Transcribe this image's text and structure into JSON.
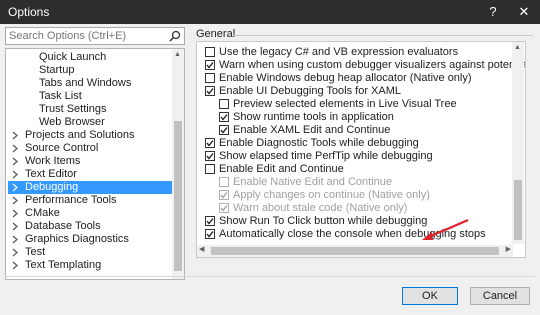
{
  "window": {
    "title": "Options",
    "help_glyph": "?",
    "close_glyph": "✕"
  },
  "search": {
    "placeholder": "Search Options (Ctrl+E)"
  },
  "tree": {
    "items": [
      {
        "label": "Quick Launch",
        "indent": 2,
        "expander": false,
        "selected": false
      },
      {
        "label": "Startup",
        "indent": 2,
        "expander": false,
        "selected": false
      },
      {
        "label": "Tabs and Windows",
        "indent": 2,
        "expander": false,
        "selected": false
      },
      {
        "label": "Task List",
        "indent": 2,
        "expander": false,
        "selected": false
      },
      {
        "label": "Trust Settings",
        "indent": 2,
        "expander": false,
        "selected": false
      },
      {
        "label": "Web Browser",
        "indent": 2,
        "expander": false,
        "selected": false
      },
      {
        "label": "Projects and Solutions",
        "indent": 1,
        "expander": true,
        "selected": false
      },
      {
        "label": "Source Control",
        "indent": 1,
        "expander": true,
        "selected": false
      },
      {
        "label": "Work Items",
        "indent": 1,
        "expander": true,
        "selected": false
      },
      {
        "label": "Text Editor",
        "indent": 1,
        "expander": true,
        "selected": false
      },
      {
        "label": "Debugging",
        "indent": 1,
        "expander": true,
        "selected": true
      },
      {
        "label": "Performance Tools",
        "indent": 1,
        "expander": true,
        "selected": false
      },
      {
        "label": "CMake",
        "indent": 1,
        "expander": true,
        "selected": false
      },
      {
        "label": "Database Tools",
        "indent": 1,
        "expander": true,
        "selected": false
      },
      {
        "label": "Graphics Diagnostics",
        "indent": 1,
        "expander": true,
        "selected": false
      },
      {
        "label": "Test",
        "indent": 1,
        "expander": true,
        "selected": false
      },
      {
        "label": "Text Templating",
        "indent": 1,
        "expander": true,
        "selected": false
      }
    ]
  },
  "section": {
    "title": "General"
  },
  "options": [
    {
      "label": "Use the legacy C# and VB expression evaluators",
      "checked": false,
      "enabled": true,
      "indent": 0
    },
    {
      "label": "Warn when using custom debugger visualizers against potentially unsafe pro",
      "checked": true,
      "enabled": true,
      "indent": 0
    },
    {
      "label": "Enable Windows debug heap allocator (Native only)",
      "checked": false,
      "enabled": true,
      "indent": 0
    },
    {
      "label": "Enable UI Debugging Tools for XAML",
      "checked": true,
      "enabled": true,
      "indent": 0
    },
    {
      "label": "Preview selected elements in Live Visual Tree",
      "checked": false,
      "enabled": true,
      "indent": 1
    },
    {
      "label": "Show runtime tools in application",
      "checked": true,
      "enabled": true,
      "indent": 1
    },
    {
      "label": "Enable XAML Edit and Continue",
      "checked": true,
      "enabled": true,
      "indent": 1
    },
    {
      "label": "Enable Diagnostic Tools while debugging",
      "checked": true,
      "enabled": true,
      "indent": 0
    },
    {
      "label": "Show elapsed time PerfTip while debugging",
      "checked": true,
      "enabled": true,
      "indent": 0
    },
    {
      "label": "Enable Edit and Continue",
      "checked": false,
      "enabled": true,
      "indent": 0
    },
    {
      "label": "Enable Native Edit and Continue",
      "checked": false,
      "enabled": false,
      "indent": 1
    },
    {
      "label": "Apply changes on continue (Native only)",
      "checked": true,
      "enabled": false,
      "indent": 1
    },
    {
      "label": "Warn about stale code (Native only)",
      "checked": true,
      "enabled": false,
      "indent": 1
    },
    {
      "label": "Show Run To Click button while debugging",
      "checked": true,
      "enabled": true,
      "indent": 0
    },
    {
      "label": "Automatically close the console when debugging stops",
      "checked": true,
      "enabled": true,
      "indent": 0
    }
  ],
  "buttons": {
    "ok": "OK",
    "cancel": "Cancel"
  },
  "colors": {
    "titlebar": "#2d2d30",
    "selection": "#3399ff",
    "annotation": "#e0202a",
    "ok_border": "#0078d7"
  },
  "icons": {
    "search": "search-icon",
    "expander": "chevron-right-icon",
    "check": "checkmark-icon",
    "annotation": "red-arrow-icon"
  }
}
